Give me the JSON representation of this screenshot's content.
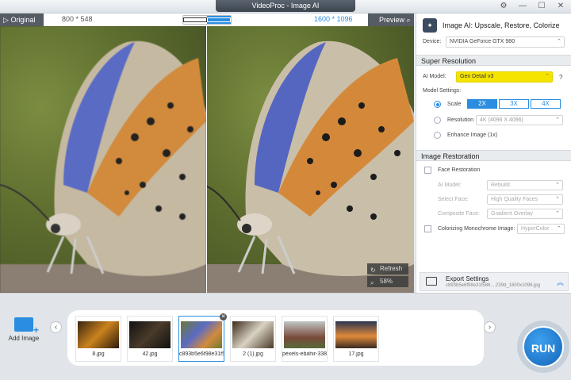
{
  "window": {
    "title": "VideoProc - Image AI"
  },
  "preview": {
    "original_label": "Original",
    "preview_label": "Preview",
    "original_dims": "800 * 548",
    "output_dims": "1600 * 1096",
    "refresh_label": "Refresh",
    "zoom_label": "58%"
  },
  "panel": {
    "title": "Image AI: Upscale, Restore, Colorize",
    "device_label": "Device:",
    "device_value": "NVIDIA GeForce GTX 980",
    "super_resolution": {
      "header": "Super Resolution",
      "ai_model_label": "AI Model:",
      "ai_model_value": "Gen Detail v3",
      "model_settings_label": "Model Settings:",
      "scale_label": "Scale",
      "scale_options": [
        "2X",
        "3X",
        "4X"
      ],
      "resolution_label": "Resolution",
      "resolution_value": "4K (4096 X 4096)",
      "enhance_label": "Enhance Image (1x)"
    },
    "image_restoration": {
      "header": "Image Restoration",
      "face_restoration_label": "Face Restoration",
      "ai_model_label": "AI Model:",
      "ai_model_value": "Rebuild",
      "select_face_label": "Select Face:",
      "select_face_value": "High Quality Faces",
      "composite_face_label": "Composite Face:",
      "composite_face_value": "Gradient Overlay",
      "colorizing_label": "Colorizing Monochrome Image:",
      "colorizing_value": "HyperColor"
    },
    "export": {
      "title": "Export Settings",
      "filename": "c893b5e6f98e31f586....239d_1600x1096.jpg"
    }
  },
  "bottom": {
    "add_image_label": "Add Image",
    "run_label": "RUN",
    "thumbnails": [
      {
        "name": "8.jpg"
      },
      {
        "name": "42.jpg"
      },
      {
        "name": "c893b5e6f98e31f586..."
      },
      {
        "name": "2 (1).jpg"
      },
      {
        "name": "pexels-ebahir-338..."
      },
      {
        "name": "17.jpg"
      }
    ]
  },
  "colors": {
    "accent": "#2a8de0",
    "highlight": "#f5e400",
    "dark": "#555c64"
  }
}
